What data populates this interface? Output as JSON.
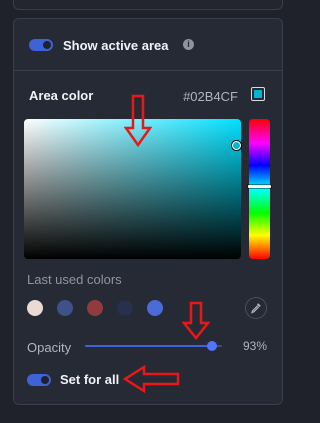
{
  "panel": {
    "show_active_area": {
      "label": "Show active area",
      "enabled": true
    },
    "area_color": {
      "title": "Area color",
      "hex": "#02B4CF",
      "color": "#02B4CF"
    },
    "picker": {
      "hue_color": "#00e1ff"
    },
    "last_used": {
      "label": "Last used colors",
      "colors": [
        "#ecd9d1",
        "#3d5289",
        "#913b3f",
        "#27304f",
        "#4b6bd8"
      ]
    },
    "opacity": {
      "label": "Opacity",
      "value_text": "93%",
      "value": 0.93
    },
    "set_for_all": {
      "label": "Set for all",
      "enabled": true
    }
  },
  "icons": {
    "info": "info-icon",
    "eyedropper": "eyedropper-icon"
  },
  "annotations": {
    "arrow_color": "#e81818"
  }
}
